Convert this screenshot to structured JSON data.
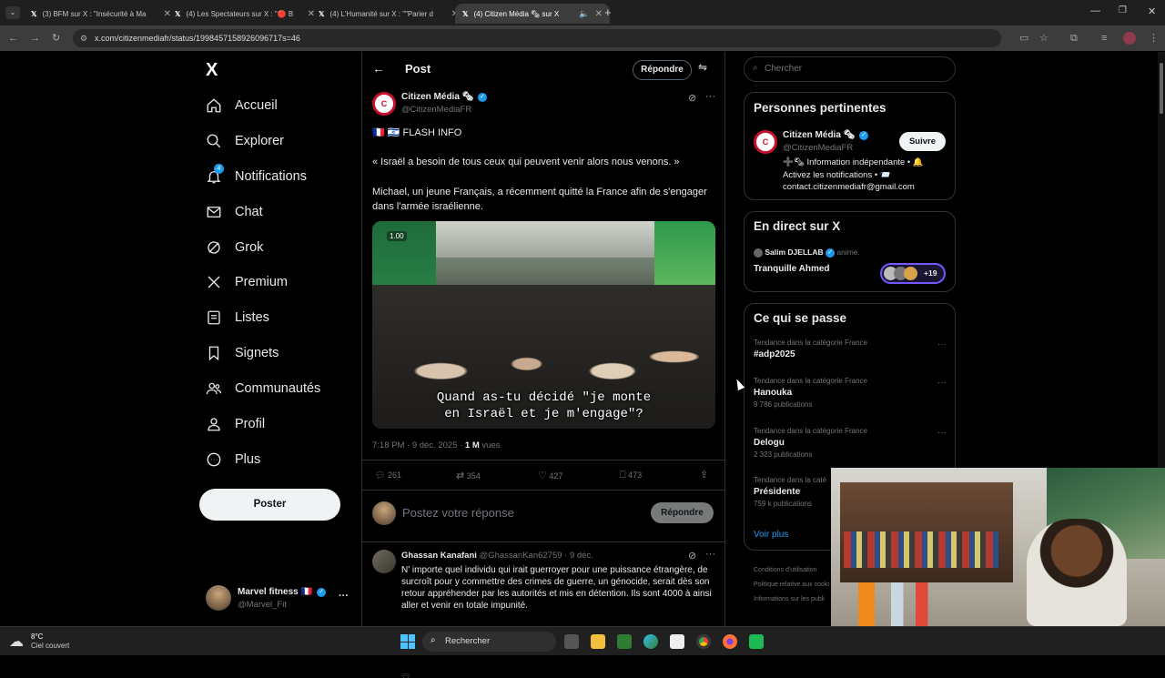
{
  "browser": {
    "tabs": [
      {
        "title": "(3) BFM sur X : \"Insécurité à Ma",
        "active": false
      },
      {
        "title": "(4) Les Spectateurs sur X : \"🔴 B",
        "active": false
      },
      {
        "title": "(4) L'Humanité sur X : \"\"Parier d",
        "active": false
      },
      {
        "title": "(4) Citizen Média 🗞 sur X",
        "active": true
      }
    ],
    "url": "x.com/citizenmediafr/status/1998457158926096717s=46"
  },
  "sidebar": {
    "logo": "X",
    "items": [
      {
        "label": "Accueil",
        "icon": "home-icon"
      },
      {
        "label": "Explorer",
        "icon": "search-icon"
      },
      {
        "label": "Notifications",
        "icon": "bell-icon",
        "badge": "4"
      },
      {
        "label": "Chat",
        "icon": "mail-icon"
      },
      {
        "label": "Grok",
        "icon": "grok-icon"
      },
      {
        "label": "Premium",
        "icon": "x-icon"
      },
      {
        "label": "Listes",
        "icon": "list-icon"
      },
      {
        "label": "Signets",
        "icon": "bookmark-icon"
      },
      {
        "label": "Communautés",
        "icon": "people-icon"
      },
      {
        "label": "Profil",
        "icon": "person-icon"
      },
      {
        "label": "Plus",
        "icon": "more-circle-icon"
      }
    ],
    "post_button": "Poster",
    "account": {
      "name": "Marvel fitness 🇫🇷",
      "handle": "@Marvel_Fit"
    }
  },
  "post": {
    "header_title": "Post",
    "reply_button": "Répondre",
    "author": {
      "name": "Citizen Média 🗞",
      "handle": "@CitizenMediaFR"
    },
    "flash": "🇫🇷 🇮🇱 FLASH INFO",
    "quote": "« Israël a besoin de tous ceux qui peuvent venir alors nous venons. »",
    "body": "Michael, un jeune Français, a récemment quitté la France afin de s'engager dans l'armée israélienne.",
    "video_subtitle_1": "Quand as-tu décidé \"je monte",
    "video_subtitle_2": "en Israël et je m'engage\"?",
    "video_badge": "1.00",
    "time": "7:18 PM · 9 déc. 2025 · ",
    "views_count": "1 M",
    "views_label": " vues",
    "stats": {
      "replies": "261",
      "reposts": "354",
      "likes": "427",
      "bookmarks": "473"
    },
    "reply_placeholder": "Postez votre réponse",
    "reply_submit": "Répondre"
  },
  "reply": {
    "name": "Ghassan Kanafani",
    "handle": "@GhassanKan62759",
    "date": "· 9 déc.",
    "text": "N' importe quel individu qui irait guerroyer pour une puissance étrangère, de surcroît pour y commettre des crimes de guerre, un génocide, serait dès son retour appréhender par les autorités et mis en détention. Ils sont 4000 à ainsi aller et venir en totale impunité."
  },
  "right": {
    "search_placeholder": "Chercher",
    "relevant": {
      "title": "Personnes pertinentes",
      "name": "Citizen Média 🗞",
      "handle": "@CitizenMediaFR",
      "follow": "Suivre",
      "bio": "➕🗞 Information indépendante • 🔔 Activez les notifications • 📨 contact.citizenmediafr@gmail.com"
    },
    "live": {
      "title": "En direct sur X",
      "host": "Salim DJELLAB",
      "host_action": "anime.",
      "space": "Tranquille Ahmed",
      "count": "+19"
    },
    "trends": {
      "title": "Ce qui se passe",
      "items": [
        {
          "meta": "Tendance dans la catégorie France",
          "name": "#adp2025",
          "count": ""
        },
        {
          "meta": "Tendance dans la catégorie France",
          "name": "Hanouka",
          "count": "9 786 publications"
        },
        {
          "meta": "Tendance dans la catégorie France",
          "name": "Delogu",
          "count": "2 323 publications"
        },
        {
          "meta": "Tendance dans la caté",
          "name": "Présidente",
          "count": "759 k publications"
        }
      ],
      "show_more": "Voir plus"
    },
    "footer": [
      "Conditions d'utilisation",
      "Politique relative aux cooki",
      "Informations sur les publi"
    ]
  },
  "taskbar": {
    "weather_temp": "8°C",
    "weather_desc": "Ciel couvert",
    "search": "Rechercher"
  }
}
